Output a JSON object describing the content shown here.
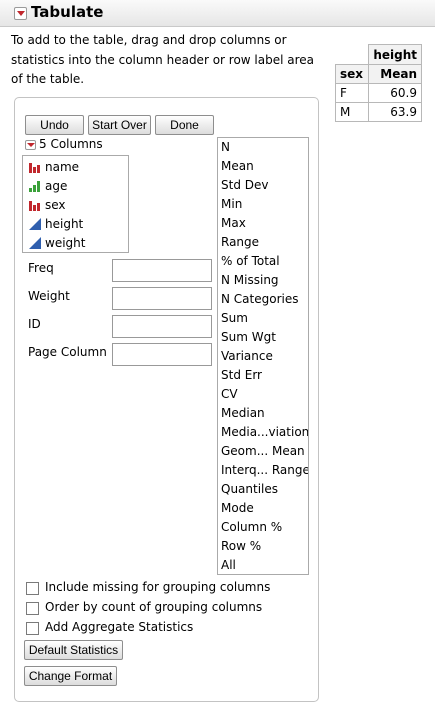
{
  "title": "Tabulate",
  "instructions": [
    "To add to the table, drag and drop columns or",
    "statistics into the column header or row label area",
    "of the table."
  ],
  "preview": {
    "col_header": "height",
    "row_header": "sex",
    "stat_header": "Mean",
    "rows": [
      {
        "label": "F",
        "value": "60.9"
      },
      {
        "label": "M",
        "value": "63.9"
      }
    ]
  },
  "buttons": {
    "undo": "Undo",
    "start_over": "Start Over",
    "done": "Done"
  },
  "columns_header": "5 Columns",
  "columns": [
    {
      "name": "name",
      "icon": "nominal-bar-icon",
      "color": "#c1272d"
    },
    {
      "name": "age",
      "icon": "ordinal-bar-icon",
      "color": "#3aa13a"
    },
    {
      "name": "sex",
      "icon": "nominal-bar-icon",
      "color": "#c1272d"
    },
    {
      "name": "height",
      "icon": "continuous-triangle-icon",
      "color": "#2f5fae"
    },
    {
      "name": "weight",
      "icon": "continuous-triangle-icon",
      "color": "#2f5fae"
    }
  ],
  "fields": [
    {
      "label": "Freq",
      "value": ""
    },
    {
      "label": "Weight",
      "value": ""
    },
    {
      "label": "ID",
      "value": ""
    },
    {
      "label": "Page Column",
      "value": ""
    }
  ],
  "statistics": [
    "N",
    "Mean",
    "Std Dev",
    "Min",
    "Max",
    "Range",
    "% of Total",
    "N Missing",
    "N Categories",
    "Sum",
    "Sum Wgt",
    "Variance",
    "Std Err",
    "CV",
    "Median",
    "Media...viation",
    "Geom... Mean",
    "Interq... Range",
    "Quantiles",
    "Mode",
    "Column %",
    "Row %",
    "All"
  ],
  "options": [
    {
      "label": "Include missing for grouping columns",
      "checked": false
    },
    {
      "label": "Order by count of grouping columns",
      "checked": false
    },
    {
      "label": "Add Aggregate Statistics",
      "checked": false
    }
  ],
  "bottom_buttons": {
    "default_statistics": "Default Statistics",
    "change_format": "Change Format"
  }
}
